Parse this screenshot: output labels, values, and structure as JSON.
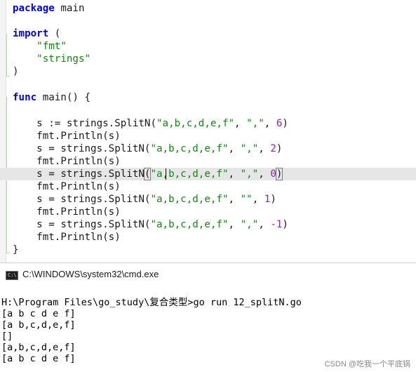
{
  "editor": {
    "lines": [
      {
        "text": "",
        "parts": [
          {
            "t": "package",
            "c": "kw"
          },
          {
            "t": " main",
            "c": ""
          }
        ]
      },
      {
        "text": "",
        "parts": []
      },
      {
        "text": "",
        "parts": [
          {
            "t": "import",
            "c": "kw"
          },
          {
            "t": " (",
            "c": ""
          }
        ]
      },
      {
        "text": "",
        "parts": [
          {
            "t": "    ",
            "c": ""
          },
          {
            "t": "\"fmt\"",
            "c": "str"
          }
        ]
      },
      {
        "text": "",
        "parts": [
          {
            "t": "    ",
            "c": ""
          },
          {
            "t": "\"strings\"",
            "c": "str"
          }
        ]
      },
      {
        "text": "",
        "parts": [
          {
            "t": ")",
            "c": ""
          }
        ]
      },
      {
        "text": "",
        "parts": []
      },
      {
        "text": "",
        "parts": [
          {
            "t": "func",
            "c": "kw"
          },
          {
            "t": " main() {",
            "c": ""
          }
        ]
      },
      {
        "text": "",
        "parts": []
      },
      {
        "text": "",
        "parts": [
          {
            "t": "    s := strings.SplitN(",
            "c": ""
          },
          {
            "t": "\"a,b,c,d,e,f\"",
            "c": "str"
          },
          {
            "t": ", ",
            "c": ""
          },
          {
            "t": "\",\"",
            "c": "str"
          },
          {
            "t": ", ",
            "c": ""
          },
          {
            "t": "6",
            "c": "num"
          },
          {
            "t": ")",
            "c": ""
          }
        ]
      },
      {
        "text": "",
        "parts": [
          {
            "t": "    fmt.Println(s)",
            "c": ""
          }
        ]
      },
      {
        "text": "",
        "parts": [
          {
            "t": "    s = strings.SplitN(",
            "c": ""
          },
          {
            "t": "\"a,b,c,d,e,f\"",
            "c": "str"
          },
          {
            "t": ", ",
            "c": ""
          },
          {
            "t": "\",\"",
            "c": "str"
          },
          {
            "t": ", ",
            "c": ""
          },
          {
            "t": "2",
            "c": "num"
          },
          {
            "t": ")",
            "c": ""
          }
        ]
      },
      {
        "text": "",
        "parts": [
          {
            "t": "    fmt.Println(s)",
            "c": ""
          }
        ]
      },
      {
        "text": "",
        "parts": [
          {
            "t": "    s = strings.SplitN",
            "c": ""
          },
          {
            "t": "(",
            "c": "bracket"
          },
          {
            "t": "\"a,b,c,d,e,f\"",
            "c": "str"
          },
          {
            "t": ", ",
            "c": ""
          },
          {
            "t": "\",\"",
            "c": "str"
          },
          {
            "t": ", ",
            "c": ""
          },
          {
            "t": "0",
            "c": "num"
          },
          {
            "t": ")",
            "c": "bracket"
          }
        ]
      },
      {
        "text": "",
        "parts": [
          {
            "t": "    fmt.Println(s)",
            "c": ""
          }
        ]
      },
      {
        "text": "",
        "parts": [
          {
            "t": "    s = strings.SplitN(",
            "c": ""
          },
          {
            "t": "\"a,b,c,d,e,f\"",
            "c": "str"
          },
          {
            "t": ", ",
            "c": ""
          },
          {
            "t": "\"\"",
            "c": "str"
          },
          {
            "t": ", ",
            "c": ""
          },
          {
            "t": "1",
            "c": "num"
          },
          {
            "t": ")",
            "c": ""
          }
        ]
      },
      {
        "text": "",
        "parts": [
          {
            "t": "    fmt.Println(s)",
            "c": ""
          }
        ]
      },
      {
        "text": "",
        "parts": [
          {
            "t": "    s = strings.SplitN(",
            "c": ""
          },
          {
            "t": "\"a,b,c,d,e,f\"",
            "c": "str"
          },
          {
            "t": ", ",
            "c": ""
          },
          {
            "t": "\",\"",
            "c": "str"
          },
          {
            "t": ", ",
            "c": ""
          },
          {
            "t": "-1",
            "c": "num"
          },
          {
            "t": ")",
            "c": ""
          }
        ]
      },
      {
        "text": "",
        "parts": [
          {
            "t": "    fmt.Println(s)",
            "c": ""
          }
        ]
      },
      {
        "text": "",
        "parts": [
          {
            "t": "}",
            "c": ""
          }
        ]
      }
    ],
    "highlighted_line": 13,
    "colors": {
      "keyword": "#0000e6",
      "string": "#118811",
      "number": "#8f1fb3",
      "highlight": "#e6e6e6"
    }
  },
  "console": {
    "title": "C:\\WINDOWS\\system32\\cmd.exe",
    "icon": "cmd-window-icon",
    "icon_text": "C:\\",
    "lines": [
      "H:\\Program Files\\go_study\\复合类型>go run 12_splitN.go",
      "[a b c d e f]",
      "[a b,c,d,e,f]",
      "[]",
      "[a,b,c,d,e,f]",
      "[a b c d e f]"
    ]
  },
  "watermark": "CSDN @吃我一个平底锅"
}
